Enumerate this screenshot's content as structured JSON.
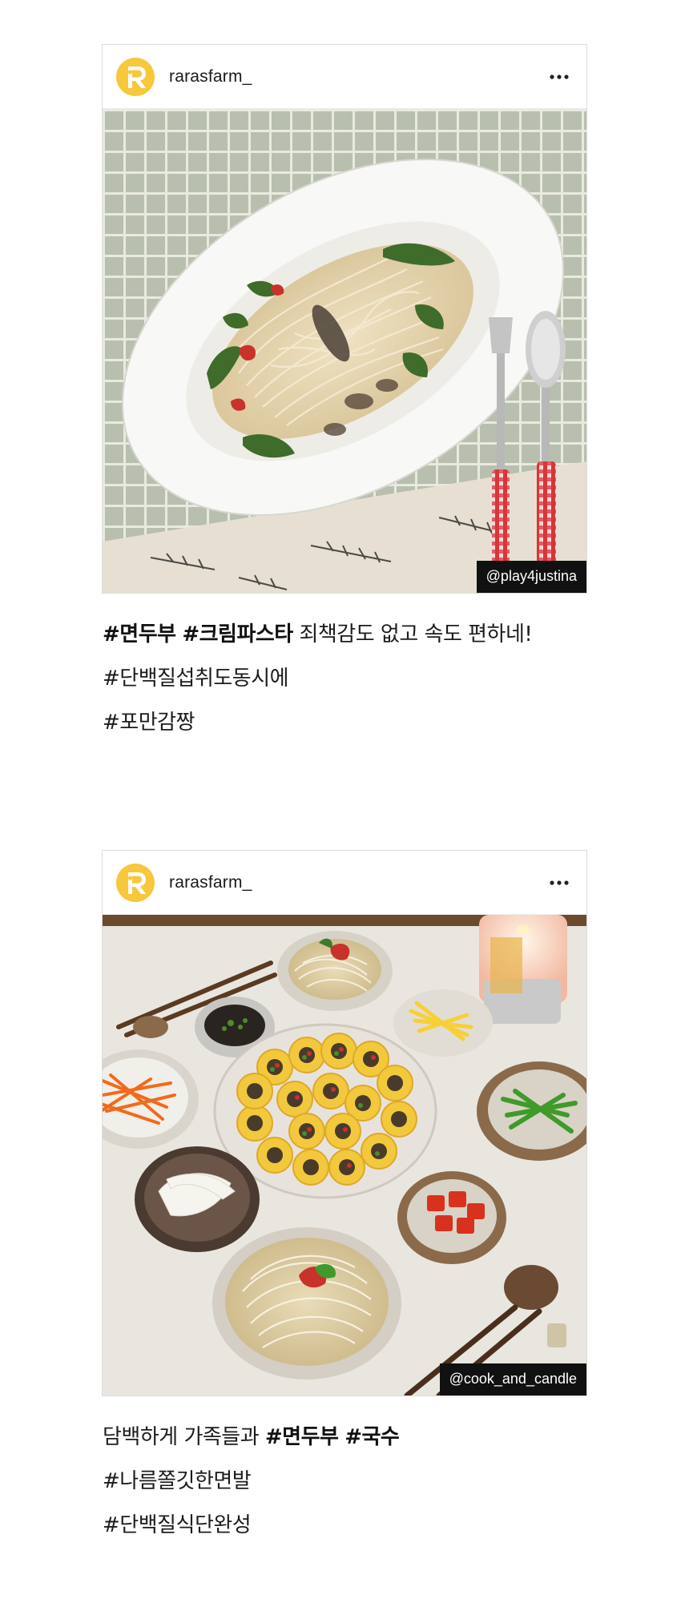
{
  "posts": [
    {
      "username": "rarasfarm_",
      "avatar_letter": "R",
      "more_icon": "more-horizontal-icon",
      "photo_subject": "cream-pasta-photo",
      "credit": "@play4justina",
      "caption": {
        "line1_tag1": "#면두부",
        "line1_tag2": "#크림파스타",
        "line1_text": "죄책감도 없고 속도 편하네!",
        "line2": "#단백질섭취도동시에",
        "line3": "#포만감짱"
      }
    },
    {
      "username": "rarasfarm_",
      "avatar_letter": "R",
      "more_icon": "more-horizontal-icon",
      "photo_subject": "korean-table-photo",
      "credit": "@cook_and_candle",
      "caption": {
        "line1_text": "담백하게 가족들과",
        "line1_tag1": "#면두부",
        "line1_tag2": "#국수",
        "line2": "#나름쫄깃한면발",
        "line3": "#단백질식단완성"
      }
    }
  ],
  "colors": {
    "avatar": "#f7c73c",
    "credit_bg": "#111111",
    "border": "#dcdcdc"
  }
}
